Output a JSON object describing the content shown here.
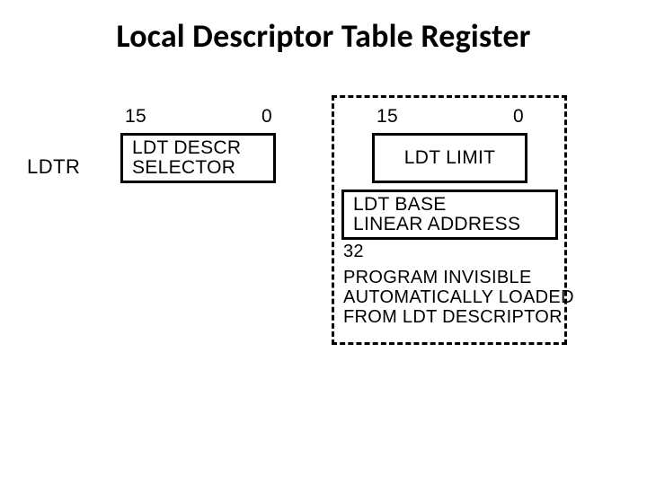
{
  "title": "Local Descriptor Table Register",
  "left": {
    "register_name": "LDTR",
    "bit_high": "15",
    "bit_low": "0",
    "box_line1": "LDT DESCR",
    "box_line2": "SELECTOR"
  },
  "right": {
    "bit_high": "15",
    "bit_low": "0",
    "limit_label": "LDT LIMIT",
    "base_line1": "LDT BASE",
    "base_line2": "LINEAR ADDRESS",
    "base_bits": "32",
    "note_line1": "PROGRAM INVISIBLE",
    "note_line2": "AUTOMATICALLY LOADED",
    "note_line3": "FROM LDT DESCRIPTOR"
  }
}
